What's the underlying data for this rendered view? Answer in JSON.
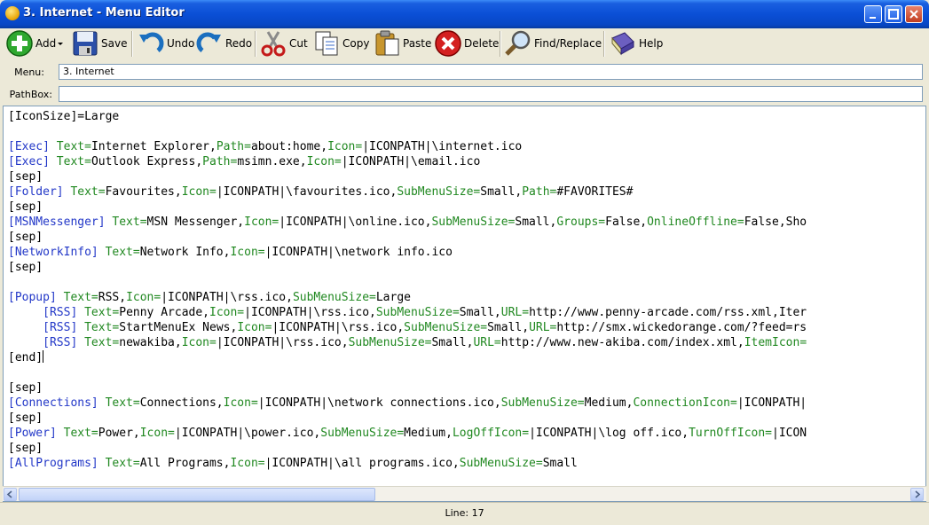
{
  "window": {
    "title": "3. Internet - Menu Editor"
  },
  "toolbar": {
    "add": "Add",
    "save": "Save",
    "undo": "Undo",
    "redo": "Redo",
    "cut": "Cut",
    "copy": "Copy",
    "paste": "Paste",
    "delete": "Delete",
    "find_replace": "Find/Replace",
    "help": "Help"
  },
  "fields": {
    "menu_label": "Menu:",
    "menu_value": "3. Internet",
    "pathbox_label": "PathBox:",
    "pathbox_value": ""
  },
  "editor": {
    "lines": [
      "[IconSize]=Large",
      "",
      "[Exec] Text=Internet Explorer,Path=about:home,Icon=|ICONPATH|\\internet.ico",
      "[Exec] Text=Outlook Express,Path=msimn.exe,Icon=|ICONPATH|\\email.ico",
      "[sep]",
      "[Folder] Text=Favourites,Icon=|ICONPATH|\\favourites.ico,SubMenuSize=Small,Path=#FAVORITES#",
      "[sep]",
      "[MSNMessenger] Text=MSN Messenger,Icon=|ICONPATH|\\online.ico,SubMenuSize=Small,Groups=False,OnlineOffline=False,Sho",
      "[sep]",
      "[NetworkInfo] Text=Network Info,Icon=|ICONPATH|\\network info.ico",
      "[sep]",
      "",
      "[Popup] Text=RSS,Icon=|ICONPATH|\\rss.ico,SubMenuSize=Large",
      "     [RSS] Text=Penny Arcade,Icon=|ICONPATH|\\rss.ico,SubMenuSize=Small,URL=http://www.penny-arcade.com/rss.xml,Iter",
      "     [RSS] Text=StartMenuEx News,Icon=|ICONPATH|\\rss.ico,SubMenuSize=Small,URL=http://smx.wickedorange.com/?feed=rs",
      "     [RSS] Text=newakiba,Icon=|ICONPATH|\\rss.ico,SubMenuSize=Small,URL=http://www.new-akiba.com/index.xml,ItemIcon=",
      "[end]",
      "",
      "[sep]",
      "[Connections] Text=Connections,Icon=|ICONPATH|\\network connections.ico,SubMenuSize=Medium,ConnectionIcon=|ICONPATH|",
      "[sep]",
      "[Power] Text=Power,Icon=|ICONPATH|\\power.ico,SubMenuSize=Medium,LogOffIcon=|ICONPATH|\\log off.ico,TurnOffIcon=|ICON",
      "[sep]",
      "[AllPrograms] Text=All Programs,Icon=|ICONPATH|\\all programs.ico,SubMenuSize=Small"
    ],
    "caret_line": 17
  },
  "status": {
    "line": "Line: 17"
  },
  "colors": {
    "section": "#2338c8",
    "key": "#208820",
    "title_bar": "#0a4fd6"
  }
}
